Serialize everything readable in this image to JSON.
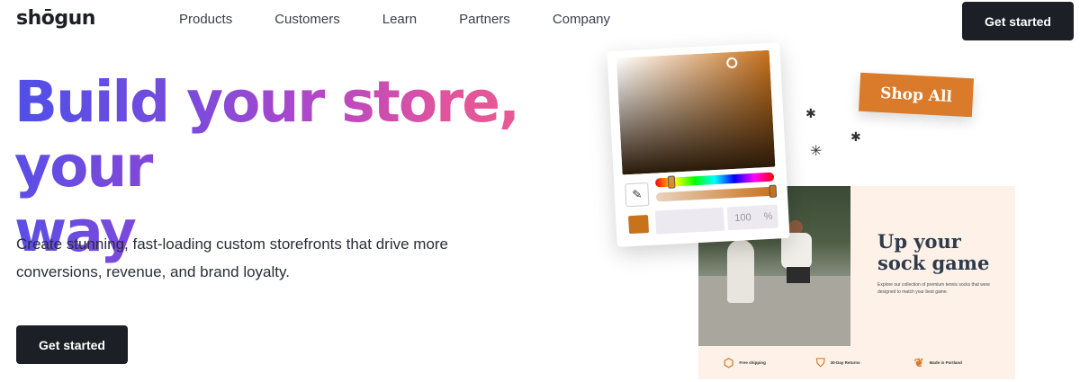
{
  "nav": {
    "logo": "shōgun",
    "links": [
      "Products",
      "Customers",
      "Learn",
      "Partners",
      "Company"
    ],
    "cta_label": "Get started"
  },
  "hero": {
    "headline_line1": "Build your store,",
    "headline_line2": "your way",
    "subtext": "Create stunning, fast-loading custom storefronts that drive more conversions, revenue, and brand loyalty.",
    "cta_label": "Get started"
  },
  "picker": {
    "alpha_value": "100",
    "alpha_unit": "%",
    "selected_color": "#c8721c"
  },
  "shop_all_label": "Shop All",
  "product_card": {
    "title": "Up your sock game",
    "description": "Explore our collection of premium tennis socks that were designed to match your best game.",
    "features": [
      {
        "icon": "box-icon",
        "label": "Free shipping"
      },
      {
        "icon": "shield-check-icon",
        "label": "30-Day Returns"
      },
      {
        "icon": "leaf-icon",
        "label": "Made in Portland"
      }
    ]
  },
  "colors": {
    "dark": "#1c1f26",
    "accent_orange": "#d97b2a",
    "gradient_start": "#4f4fe8",
    "gradient_end": "#e85a92"
  }
}
